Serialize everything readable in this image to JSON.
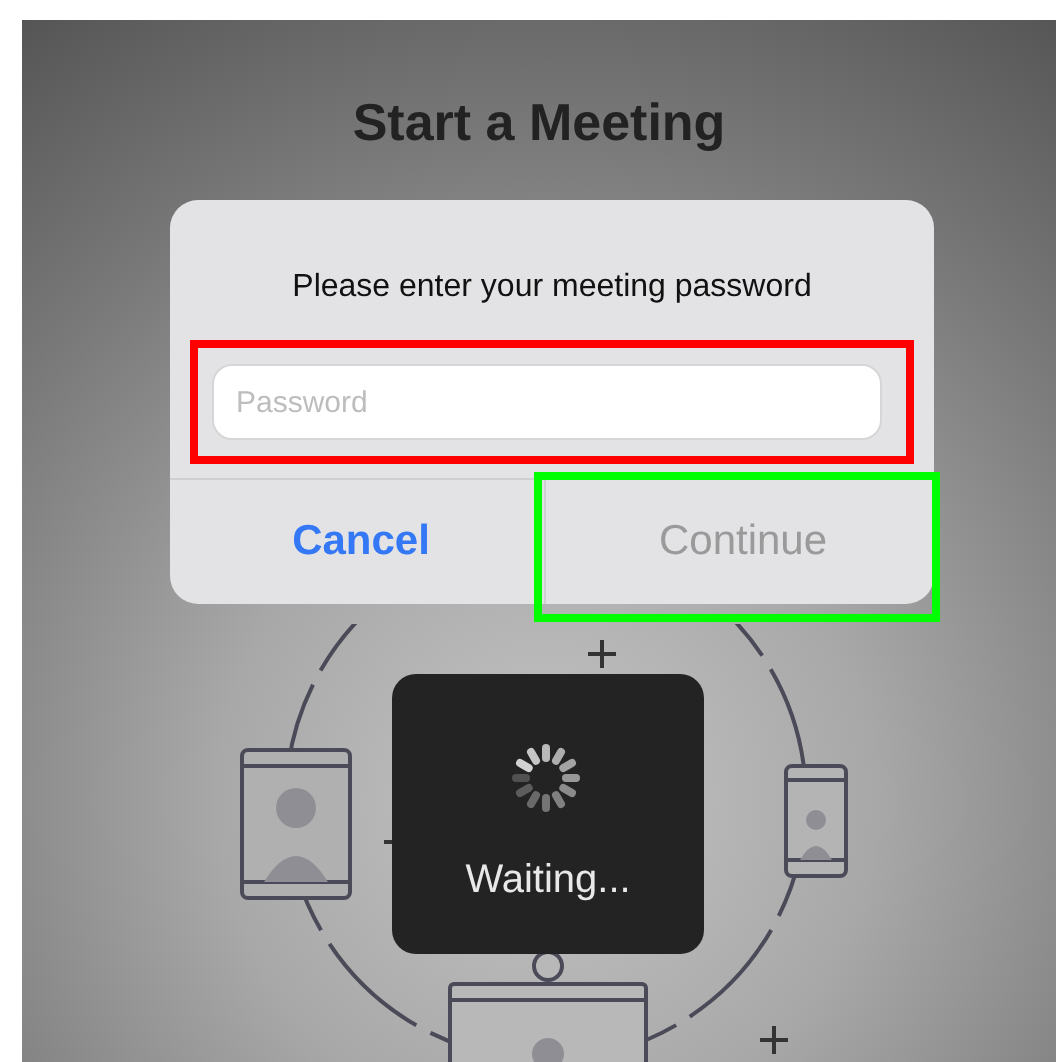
{
  "title": "Start a Meeting",
  "dialog": {
    "message": "Please enter your meeting password",
    "password_field": {
      "placeholder": "Password",
      "highlighted": true
    },
    "buttons": [
      {
        "label": "Cancel",
        "disabled": false,
        "highlighted": false
      },
      {
        "label": "Continue",
        "disabled": true,
        "highlighted": true
      }
    ]
  },
  "hud": {
    "text": "Waiting..."
  }
}
